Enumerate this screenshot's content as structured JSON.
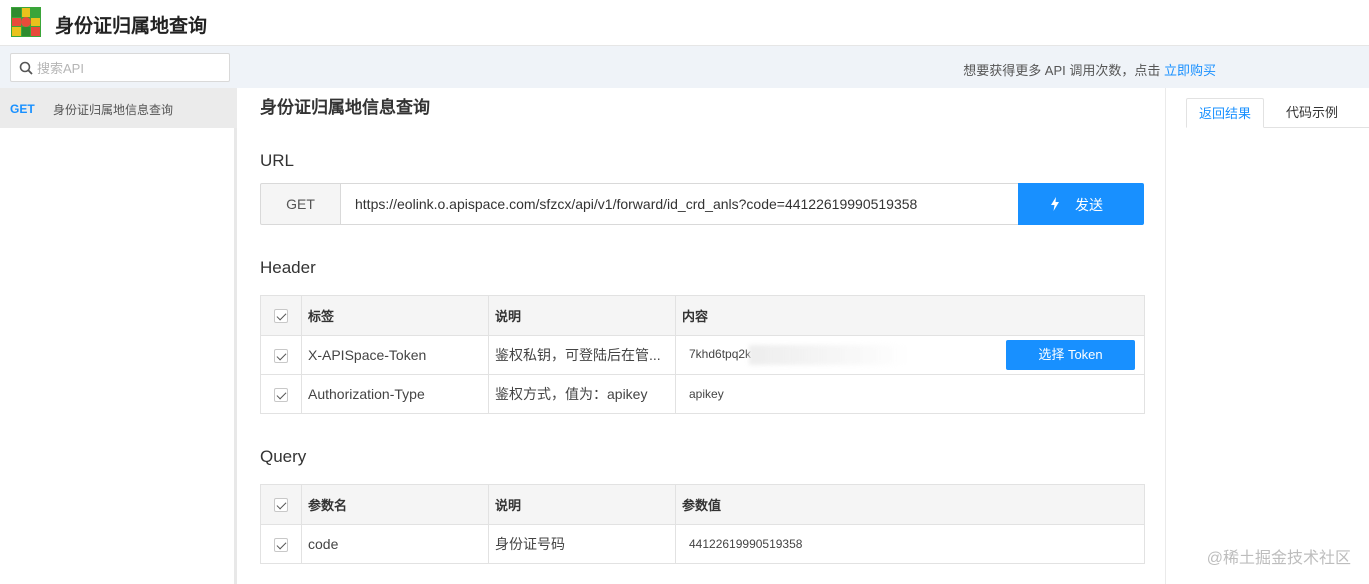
{
  "header": {
    "title": "身份证归属地查询",
    "logo_icon": "app-logo-icon"
  },
  "search": {
    "placeholder": "搜索API"
  },
  "promo": {
    "text": "想要获得更多 API 调用次数，点击 ",
    "link": "立即购买"
  },
  "sidebar": {
    "items": [
      {
        "method": "GET",
        "label": "身份证归属地信息查询"
      }
    ]
  },
  "main": {
    "title": "身份证归属地信息查询",
    "url_section": "URL",
    "method": "GET",
    "url": "https://eolink.o.apispace.com/sfzcx/api/v1/forward/id_crd_anls?code=44122619990519358",
    "send_label": "发送",
    "header_section": "Header",
    "header_table": {
      "columns": [
        "标签",
        "说明",
        "内容"
      ],
      "rows": [
        {
          "name": "X-APISpace-Token",
          "desc": "鉴权私钥，可登陆后在管...",
          "value": "7khd6tpq2k"
        },
        {
          "name": "Authorization-Type",
          "desc": "鉴权方式，值为：apikey",
          "value": "apikey"
        }
      ],
      "token_button": "选择 Token"
    },
    "query_section": "Query",
    "query_table": {
      "columns": [
        "参数名",
        "说明",
        "参数值"
      ],
      "rows": [
        {
          "name": "code",
          "desc": "身份证号码",
          "value": "44122619990519358"
        }
      ]
    }
  },
  "right_panel": {
    "tabs": [
      "返回结果",
      "代码示例"
    ]
  },
  "watermark": "@稀土掘金技术社区",
  "colors": {
    "accent": "#1890ff",
    "subbar_bg": "#eff3f8"
  }
}
